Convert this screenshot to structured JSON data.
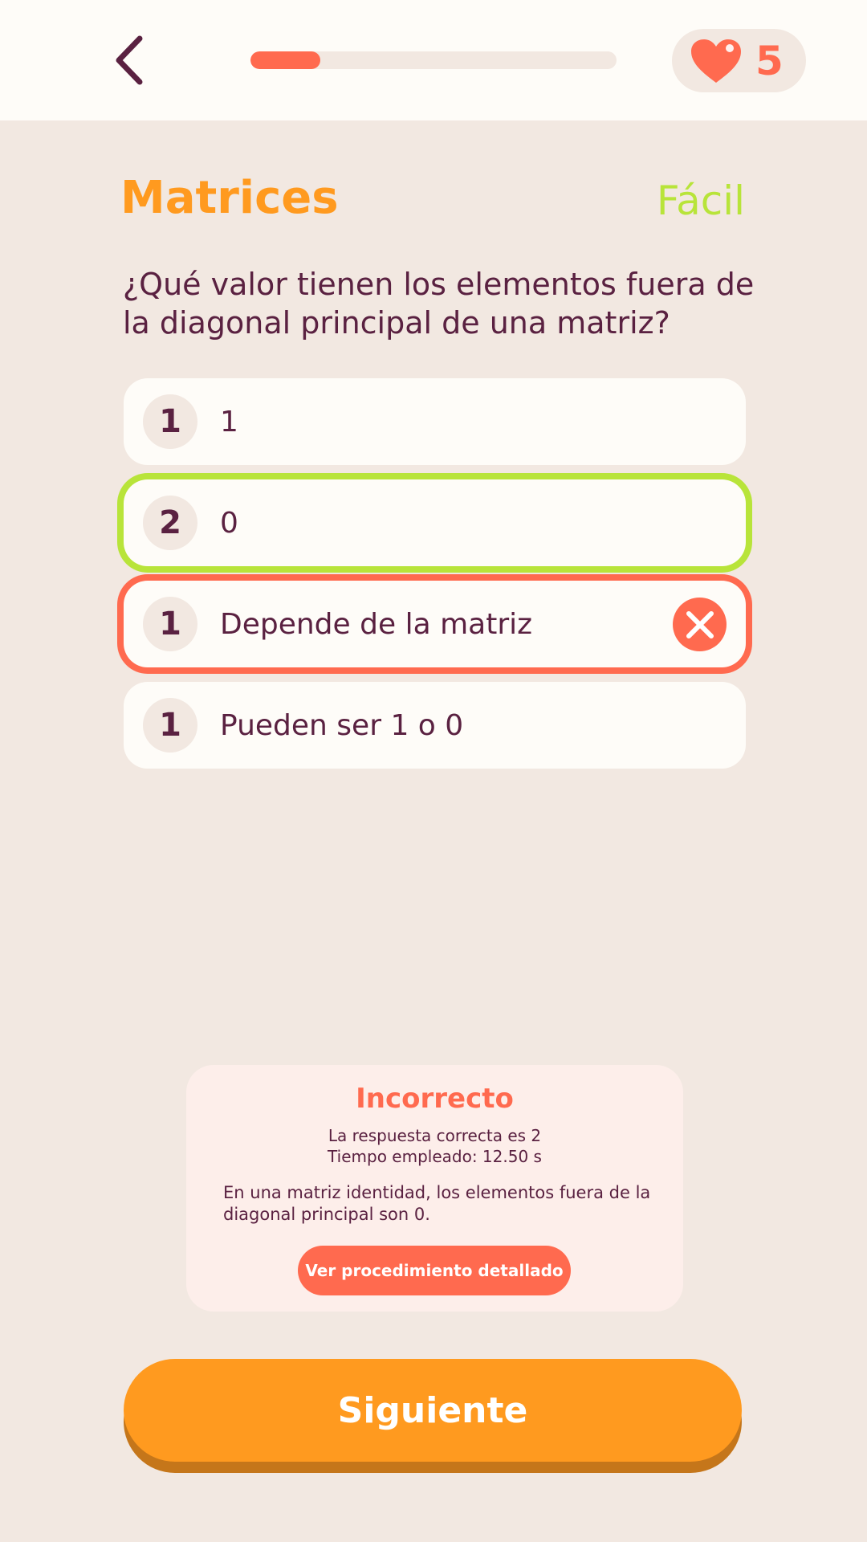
{
  "header": {
    "back_icon": "chevron-left-icon",
    "progress_fraction": 0.19,
    "lives_icon": "heart-icon",
    "lives": "5"
  },
  "quiz": {
    "topic": "Matrices",
    "difficulty": "Fácil",
    "question": "¿Qué valor tienen los elementos fuera de la diagonal principal de una matriz?",
    "options": [
      {
        "badge": "1",
        "text": "1",
        "state": "neutral"
      },
      {
        "badge": "2",
        "text": "0",
        "state": "correct"
      },
      {
        "badge": "1",
        "text": "Depende de la matriz",
        "state": "wrong"
      },
      {
        "badge": "1",
        "text": "Pueden ser 1 o 0",
        "state": "neutral"
      }
    ]
  },
  "feedback": {
    "title": "Incorrecto",
    "correct_answer": "La respuesta correcta es 2",
    "time_spent": "Tiempo empleado: 12.50 s",
    "explanation": "En una matriz identidad, los elementos fuera de la diagonal principal son 0.",
    "details_button": "Ver procedimiento detallado"
  },
  "footer": {
    "next_button": "Siguiente"
  },
  "colors": {
    "accent_orange": "#ff9a1f",
    "accent_red": "#ff6a4f",
    "accent_green": "#b8e43a",
    "text": "#5a2141",
    "background": "#f2e8e1"
  }
}
